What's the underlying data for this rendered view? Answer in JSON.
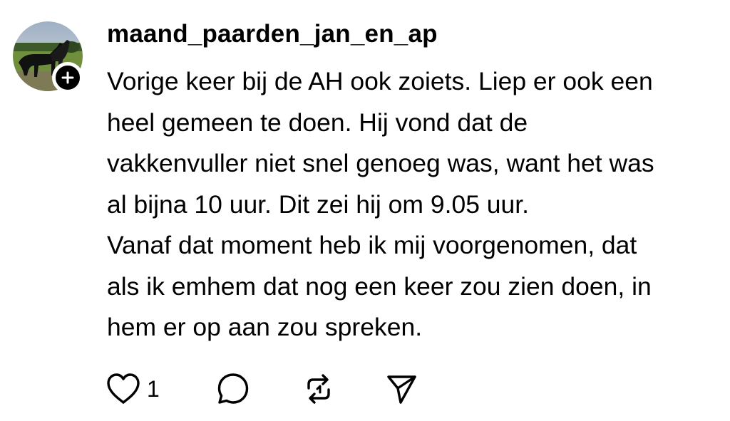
{
  "post": {
    "username": "maand_paarden_jan_en_ap",
    "text_lines": [
      "Vorige keer bij de AH ook zoiets. Liep er ook een",
      "heel gemeen te doen. Hij vond dat de",
      "vakkenvuller niet snel genoeg was, want het was",
      "al bijna 10 uur. Dit zei hij om 9.05 uur.",
      "Vanaf dat moment heb ik mij voorgenomen, dat",
      "als ik emhem dat nog een keer zou zien doen, in",
      "hem er op aan zou spreken."
    ],
    "avatar_icon": "horses-in-field",
    "follow_icon": "plus-icon"
  },
  "actions": {
    "like": {
      "icon": "heart-icon",
      "count": "1"
    },
    "reply": {
      "icon": "comment-icon"
    },
    "repost": {
      "icon": "repost-icon"
    },
    "share": {
      "icon": "send-icon"
    }
  },
  "colors": {
    "text": "#000000",
    "background": "#ffffff"
  }
}
